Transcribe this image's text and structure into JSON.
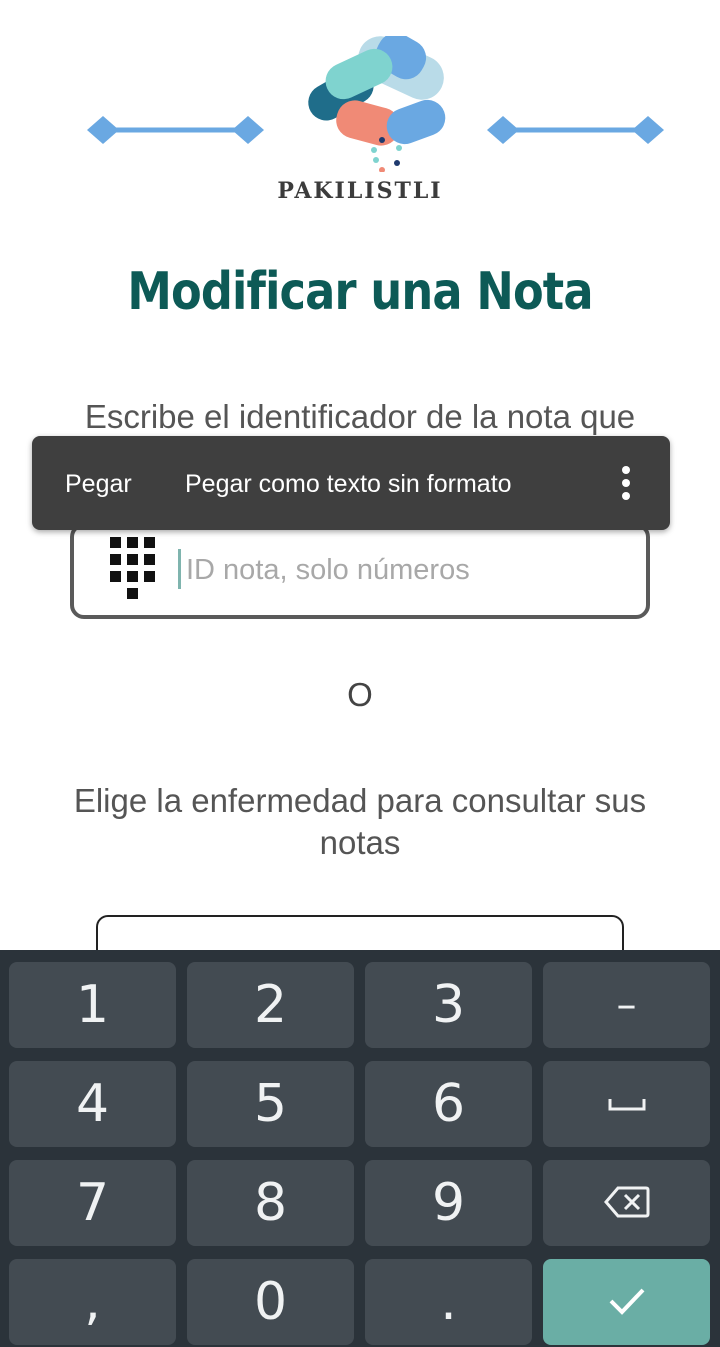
{
  "logo": {
    "text": "PAKILISTLI"
  },
  "title": "Modificar una Nota",
  "instruction": "Escribe el identificador de la nota que",
  "context_menu": {
    "paste": "Pegar",
    "paste_plain": "Pegar como texto sin formato",
    "more_icon": "more-vertical-icon"
  },
  "id_field": {
    "placeholder": "ID nota, solo números",
    "icon": "dialpad-icon"
  },
  "or_label": "O",
  "disease_prompt": "Elige la enfermedad para consultar sus notas",
  "keyboard": {
    "row1": [
      "1",
      "2",
      "3",
      "–"
    ],
    "row2": [
      "4",
      "5",
      "6"
    ],
    "row3": [
      "7",
      "8",
      "9"
    ],
    "row4": [
      ",",
      "0",
      "."
    ],
    "space_icon": "space-icon",
    "backspace_icon": "backspace-icon",
    "confirm_icon": "check-icon"
  },
  "colors": {
    "title": "#0d5a56",
    "keyboard_bg": "#2b333a",
    "key_bg": "#434b52",
    "confirm_key": "#6aaea5",
    "logo_blue": "#6aa8e2"
  }
}
